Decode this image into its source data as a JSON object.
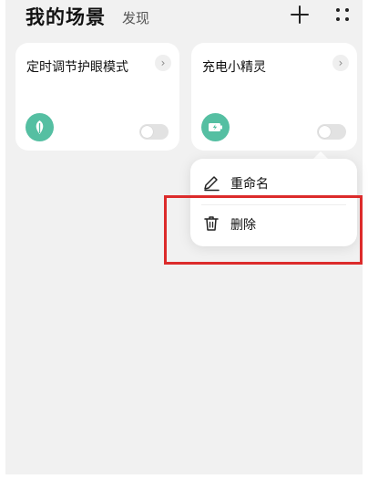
{
  "header": {
    "title": "我的场景",
    "tab": "发现",
    "add_icon": "plus-icon",
    "more_icon": "grid-dots-icon"
  },
  "scenes": [
    {
      "title": "定时调节护眼模式",
      "icon": "leaf-icon",
      "enabled": false
    },
    {
      "title": "充电小精灵",
      "icon": "battery-icon",
      "enabled": false
    }
  ],
  "context_menu": {
    "items": [
      {
        "label": "重命名",
        "icon": "pencil-icon"
      },
      {
        "label": "删除",
        "icon": "trash-icon"
      }
    ]
  },
  "colors": {
    "accent_teal": "#55bfa2",
    "highlight_red": "#dc2b2b"
  }
}
